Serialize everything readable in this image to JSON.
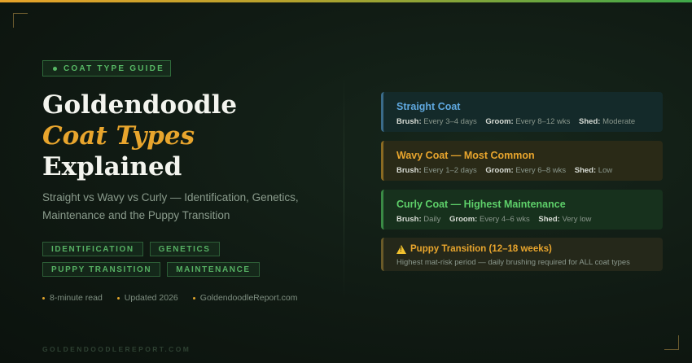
{
  "eyebrow": "COAT TYPE GUIDE",
  "title": {
    "line1": "Goldendoodle",
    "line2": "Coat Types",
    "line3": "Explained"
  },
  "subtitle": "Straight vs Wavy vs Curly — Identification, Genetics, Maintenance and the Puppy Transition",
  "tags": {
    "row1": [
      "IDENTIFICATION",
      "GENETICS"
    ],
    "row2": [
      "PUPPY TRANSITION",
      "MAINTENANCE"
    ]
  },
  "meta": [
    "8-minute read",
    "Updated 2026",
    "GoldendoodleReport.com"
  ],
  "footer": "GOLDENDOODLEREPORT.COM",
  "cards": [
    {
      "title": "Straight Coat",
      "brush_label": "Brush:",
      "brush": "Every 3–4 days",
      "groom_label": "Groom:",
      "groom": "Every 8–12 wks",
      "shed_label": "Shed:",
      "shed": "Moderate"
    },
    {
      "title": "Wavy Coat — Most Common",
      "brush_label": "Brush:",
      "brush": "Every 1–2 days",
      "groom_label": "Groom:",
      "groom": "Every 6–8 wks",
      "shed_label": "Shed:",
      "shed": "Low"
    },
    {
      "title": "Curly Coat — Highest Maintenance",
      "brush_label": "Brush:",
      "brush": "Daily",
      "groom_label": "Groom:",
      "groom": "Every 4–6 wks",
      "shed_label": "Shed:",
      "shed": "Very low"
    }
  ],
  "transition": {
    "icon": "warning-icon",
    "title": "Puppy Transition (12–18 weeks)",
    "text": "Highest mat-risk period — daily brushing required for ALL coat types"
  },
  "colors": {
    "accent_gold": "#e8a52d",
    "accent_green": "#57b865",
    "straight_blue": "#5fa8df",
    "curly_green": "#5ed06a"
  }
}
